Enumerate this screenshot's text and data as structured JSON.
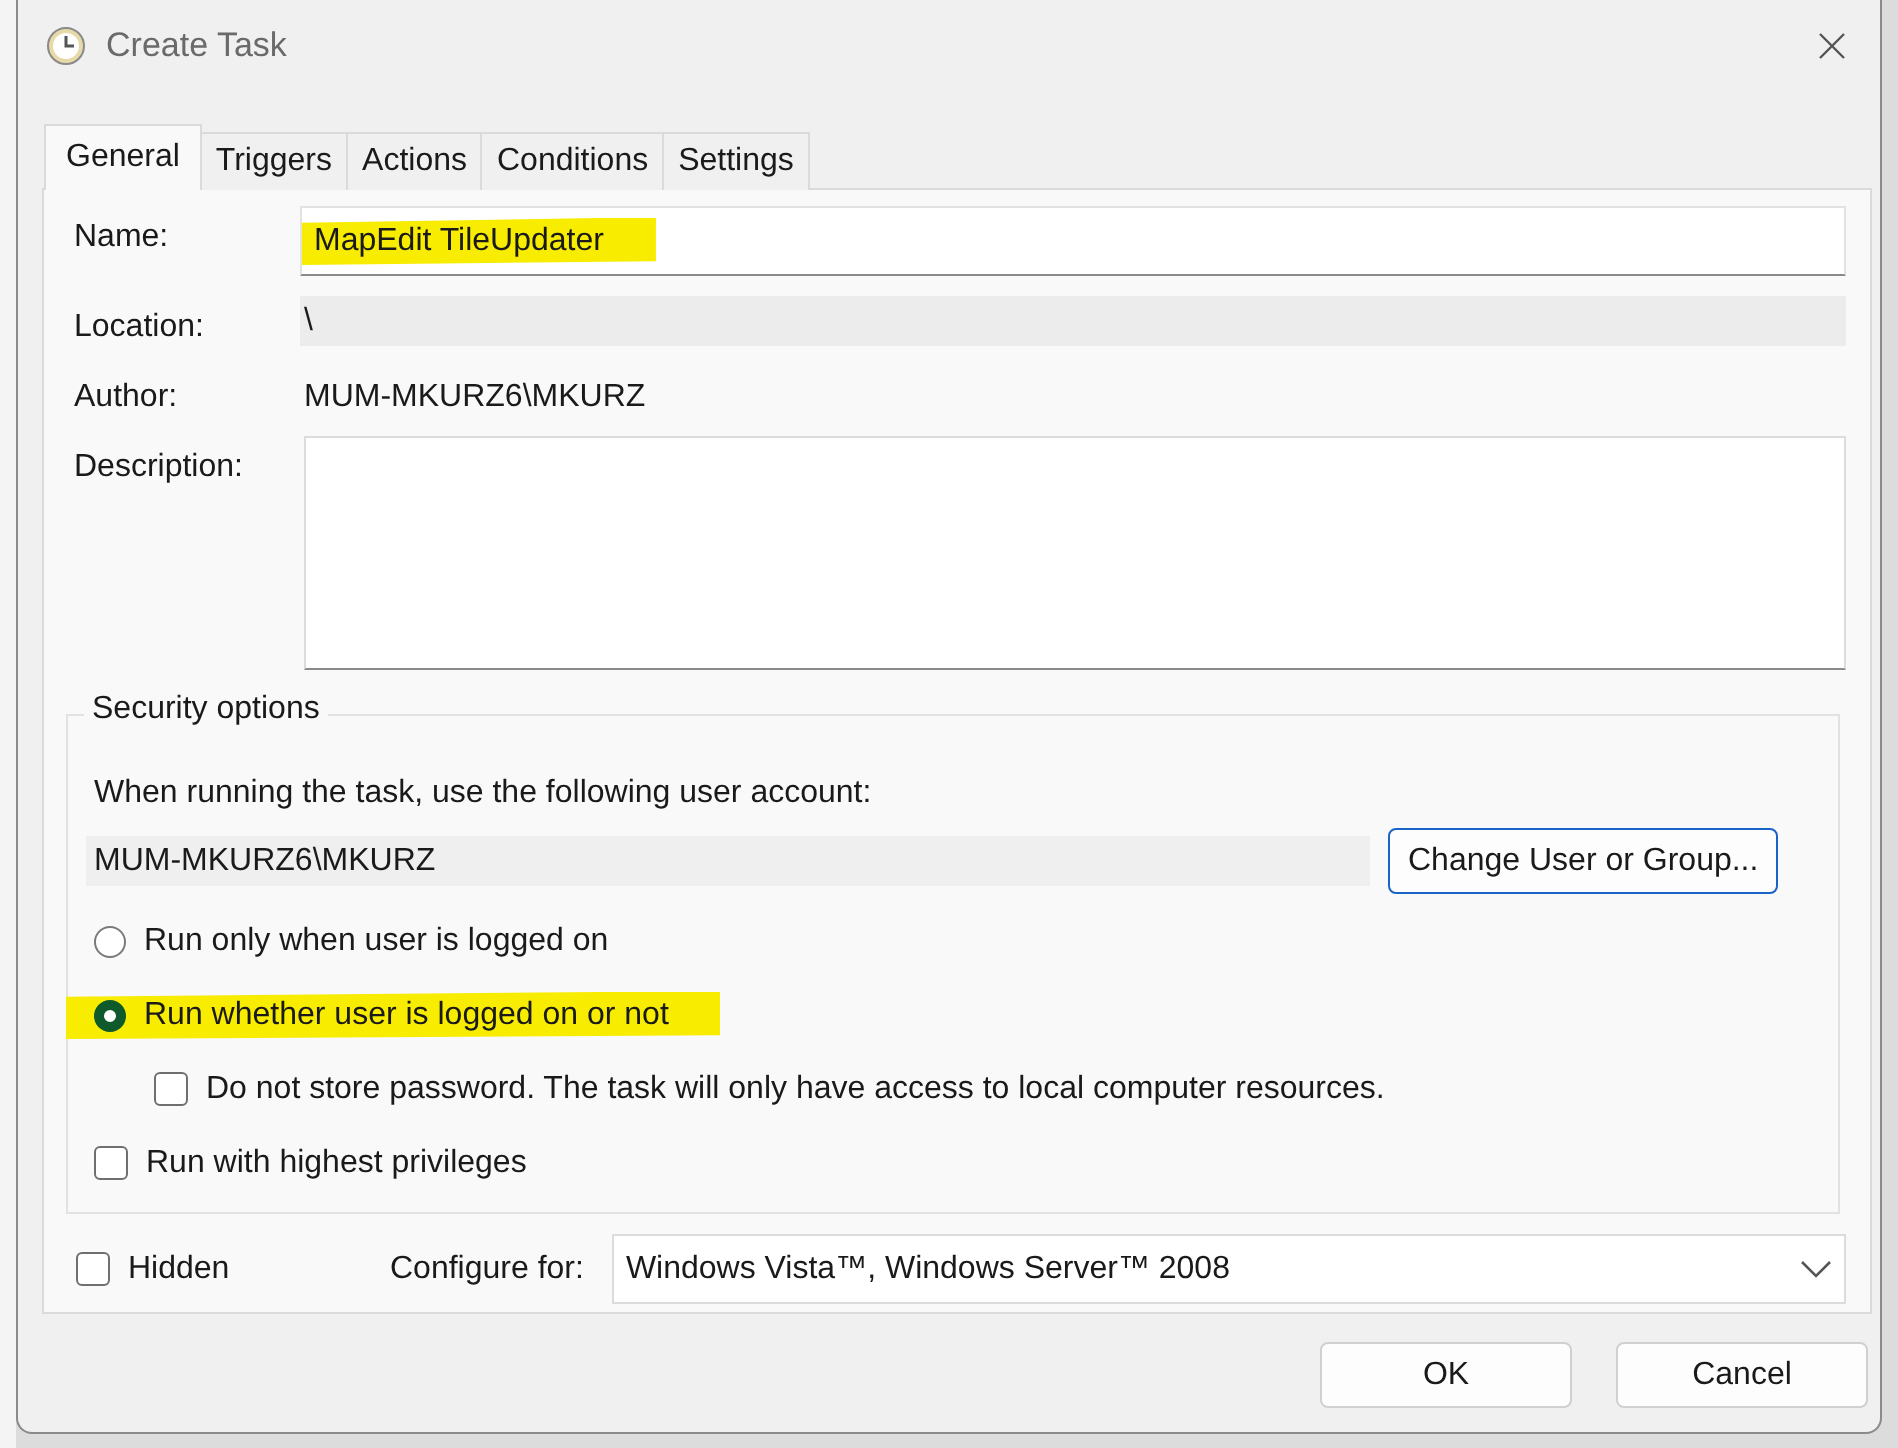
{
  "window": {
    "title": "Create Task"
  },
  "tabs": [
    {
      "label": "General",
      "selected": true
    },
    {
      "label": "Triggers",
      "selected": false
    },
    {
      "label": "Actions",
      "selected": false
    },
    {
      "label": "Conditions",
      "selected": false
    },
    {
      "label": "Settings",
      "selected": false
    }
  ],
  "fields": [
    {
      "label": "Name:",
      "kind": "input",
      "value": "MapEdit TileUpdater",
      "highlighted": true
    },
    {
      "label": "Location:",
      "kind": "readonly",
      "value": "\\"
    },
    {
      "label": "Author:",
      "kind": "text",
      "value": "MUM-MKURZ6\\MKURZ"
    },
    {
      "label": "Description:",
      "kind": "textarea"
    }
  ],
  "security": {
    "title": "Security options",
    "prompt": "When running the task, use the following user account:",
    "account": "MUM-MKURZ6\\MKURZ",
    "change_button": "Change User or Group...",
    "options": [
      {
        "kind": "radio",
        "label": "Run only when user is logged on",
        "selected": false,
        "highlighted": false
      },
      {
        "kind": "radio",
        "label": "Run whether user is logged on or not",
        "selected": true,
        "highlighted": true
      },
      {
        "kind": "checkbox",
        "label": "Do not store password.  The task will only have access to local computer resources.",
        "checked": false,
        "indented": true
      },
      {
        "kind": "checkbox",
        "label": "Run with highest privileges",
        "checked": false,
        "indented": false
      }
    ]
  },
  "hidden": {
    "label": "Hidden",
    "checked": false
  },
  "configure": {
    "label": "Configure for:",
    "value": "Windows Vista™, Windows Server™ 2008"
  },
  "buttons": [
    "OK",
    "Cancel"
  ]
}
